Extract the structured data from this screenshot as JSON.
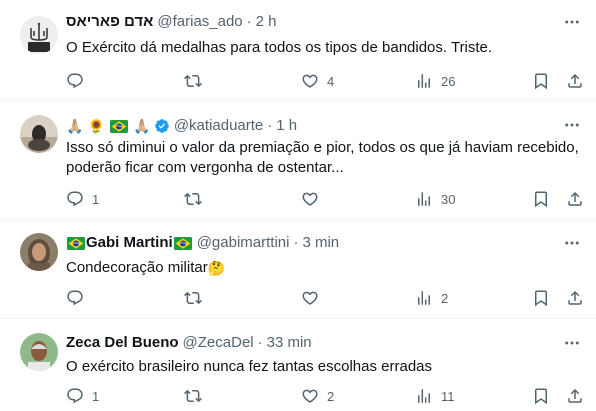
{
  "tweets": [
    {
      "name": "אדם פאריאס",
      "handle": "@farias_ado",
      "dot": "·",
      "time": "2 h",
      "text": "O Exército dá medalhas para todos os tipos de bandidos. Triste.",
      "replies": "",
      "retweets": "",
      "likes": "4",
      "views": "26"
    },
    {
      "name": "",
      "handle": "@katiaduarte",
      "dot": "·",
      "time": "1 h",
      "text": "Isso só diminui o valor da premiação e pior, todos os que já haviam recebido, poderão ficar com vergonha de ostentar...",
      "replies": "1",
      "retweets": "",
      "likes": "",
      "views": "30"
    },
    {
      "name": "Gabi Martini",
      "handle": "@gabimarttini",
      "dot": "·",
      "time": "3 min",
      "text": "Condecoração militar",
      "replies": "",
      "retweets": "",
      "likes": "",
      "views": "2"
    },
    {
      "name": "Zeca Del Bueno",
      "handle": "@ZecaDel",
      "dot": "·",
      "time": "33 min",
      "text": "O exército brasileiro nunca fez tantas escolhas erradas",
      "replies": "1",
      "retweets": "",
      "likes": "2",
      "views": "11"
    }
  ],
  "icons": {
    "more": "more-icon",
    "reply": "reply-icon",
    "retweet": "retweet-icon",
    "like": "like-icon",
    "views": "views-icon",
    "bookmark": "bookmark-icon",
    "share": "share-icon"
  },
  "colors": {
    "text": "#0f1419",
    "secondary": "#536471",
    "verified": "#1d9bf0",
    "divider": "#eff3f4"
  }
}
